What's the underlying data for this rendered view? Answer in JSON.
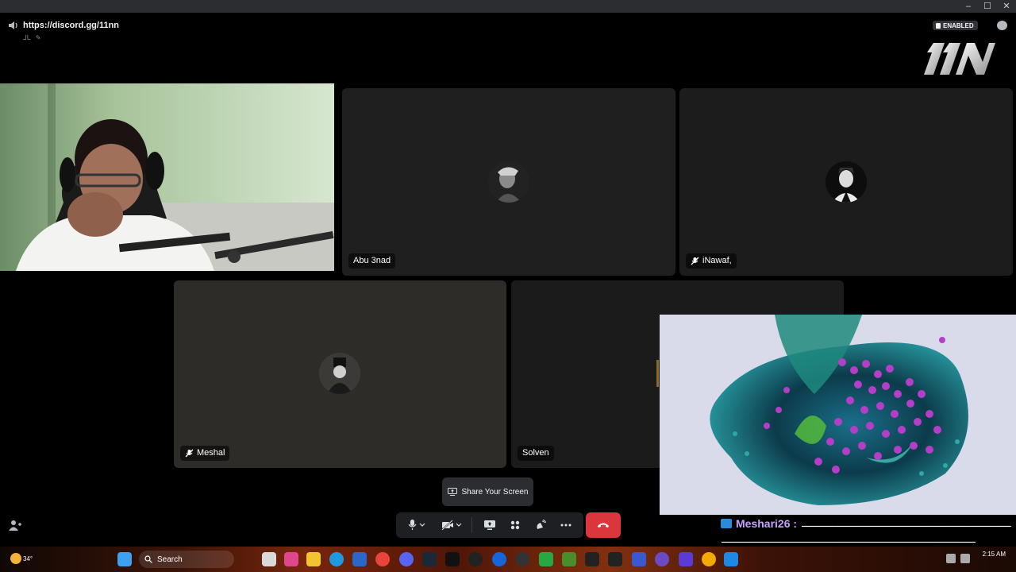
{
  "header": {
    "title": "https://discord.gg/11nn",
    "subtitle": "ـالـ",
    "badge": "ENABLED",
    "logo_text": "11N"
  },
  "window_controls": {
    "minimize": "–",
    "maximize": "☐",
    "close": "✕"
  },
  "participants": [
    {
      "name": "",
      "has_video": true
    },
    {
      "name": "Abu 3nad",
      "has_video": false,
      "muted": false
    },
    {
      "name": "iNawaf,",
      "has_video": false,
      "muted": true
    },
    {
      "name": "Meshal",
      "has_video": false,
      "muted": true
    },
    {
      "name": "Solven",
      "has_video": false,
      "muted": false
    }
  ],
  "controls": {
    "share_label": "Share Your Screen",
    "mic_icon": "microphone-icon",
    "camera_icon": "camera-off-icon",
    "screen_icon": "screen-share-icon",
    "activities_icon": "activities-icon",
    "soundboard_icon": "soundboard-icon",
    "more_icon": "more-icon",
    "hangup_icon": "hangup-icon"
  },
  "chat": {
    "username": "Meshari26 :",
    "message_line1": "ـــــــــــــــــــــــــــــــــــــــــــــــــــــــــــــــــــــــــــ",
    "message_line2": "ـــــــــــــــــــــــــــــــــــــــــــــــــــــــــــــــــــــــــــــــــــــــــــ"
  },
  "taskbar": {
    "weather": "34°",
    "search_placeholder": "Search",
    "time": "2:15 AM"
  },
  "colors": {
    "accent_red": "#da373c",
    "chat_name": "#c8a2ff"
  }
}
